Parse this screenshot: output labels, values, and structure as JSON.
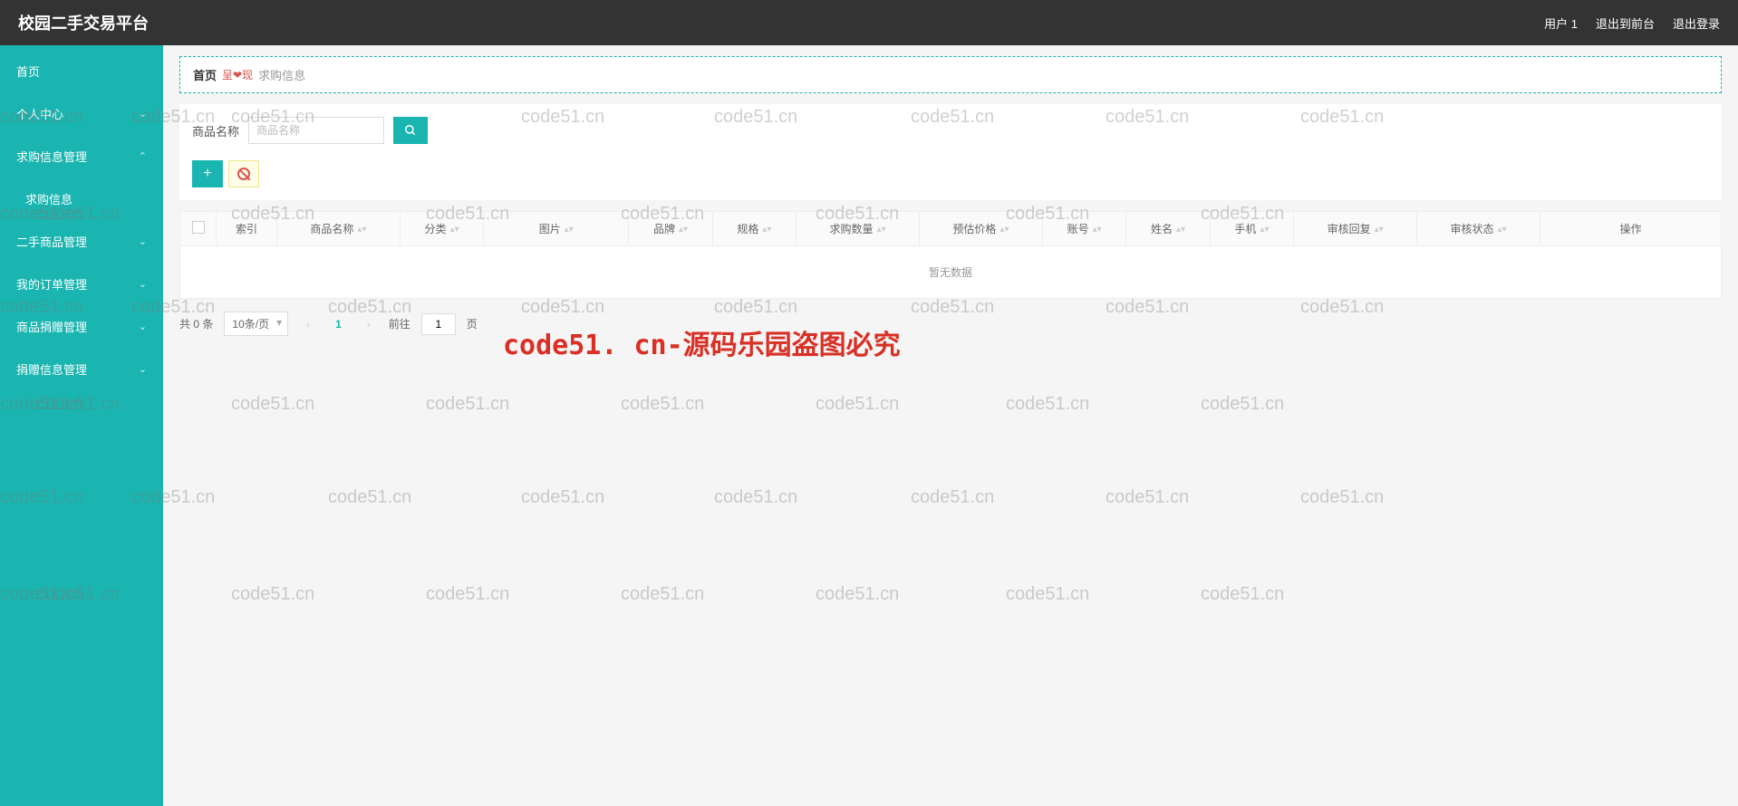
{
  "header": {
    "title": "校园二手交易平台",
    "user": "用户 1",
    "back_to_front": "退出到前台",
    "logout": "退出登录"
  },
  "sidebar": {
    "items": [
      {
        "label": "首页",
        "expandable": false
      },
      {
        "label": "个人中心",
        "expandable": true
      },
      {
        "label": "求购信息管理",
        "expandable": true,
        "expanded": true
      },
      {
        "label": "求购信息",
        "expandable": false,
        "sub": true
      },
      {
        "label": "二手商品管理",
        "expandable": true
      },
      {
        "label": "我的订单管理",
        "expandable": true
      },
      {
        "label": "商品捐赠管理",
        "expandable": true
      },
      {
        "label": "捐赠信息管理",
        "expandable": true
      }
    ]
  },
  "breadcrumb": {
    "home": "首页",
    "separator": "呈❤现",
    "current": "求购信息"
  },
  "search": {
    "label": "商品名称",
    "placeholder": "商品名称"
  },
  "table": {
    "columns": [
      "索引",
      "商品名称",
      "分类",
      "图片",
      "品牌",
      "规格",
      "求购数量",
      "预估价格",
      "账号",
      "姓名",
      "手机",
      "审核回复",
      "审核状态",
      "操作"
    ],
    "empty": "暂无数据"
  },
  "pagination": {
    "total_prefix": "共",
    "total_count": "0",
    "total_suffix": "条",
    "page_size": "10条/页",
    "current_page": "1",
    "goto_prefix": "前往",
    "goto_value": "1",
    "goto_suffix": "页"
  },
  "watermark": {
    "small": "code51.cn",
    "big": "code51. cn-源码乐园盗图必究"
  }
}
